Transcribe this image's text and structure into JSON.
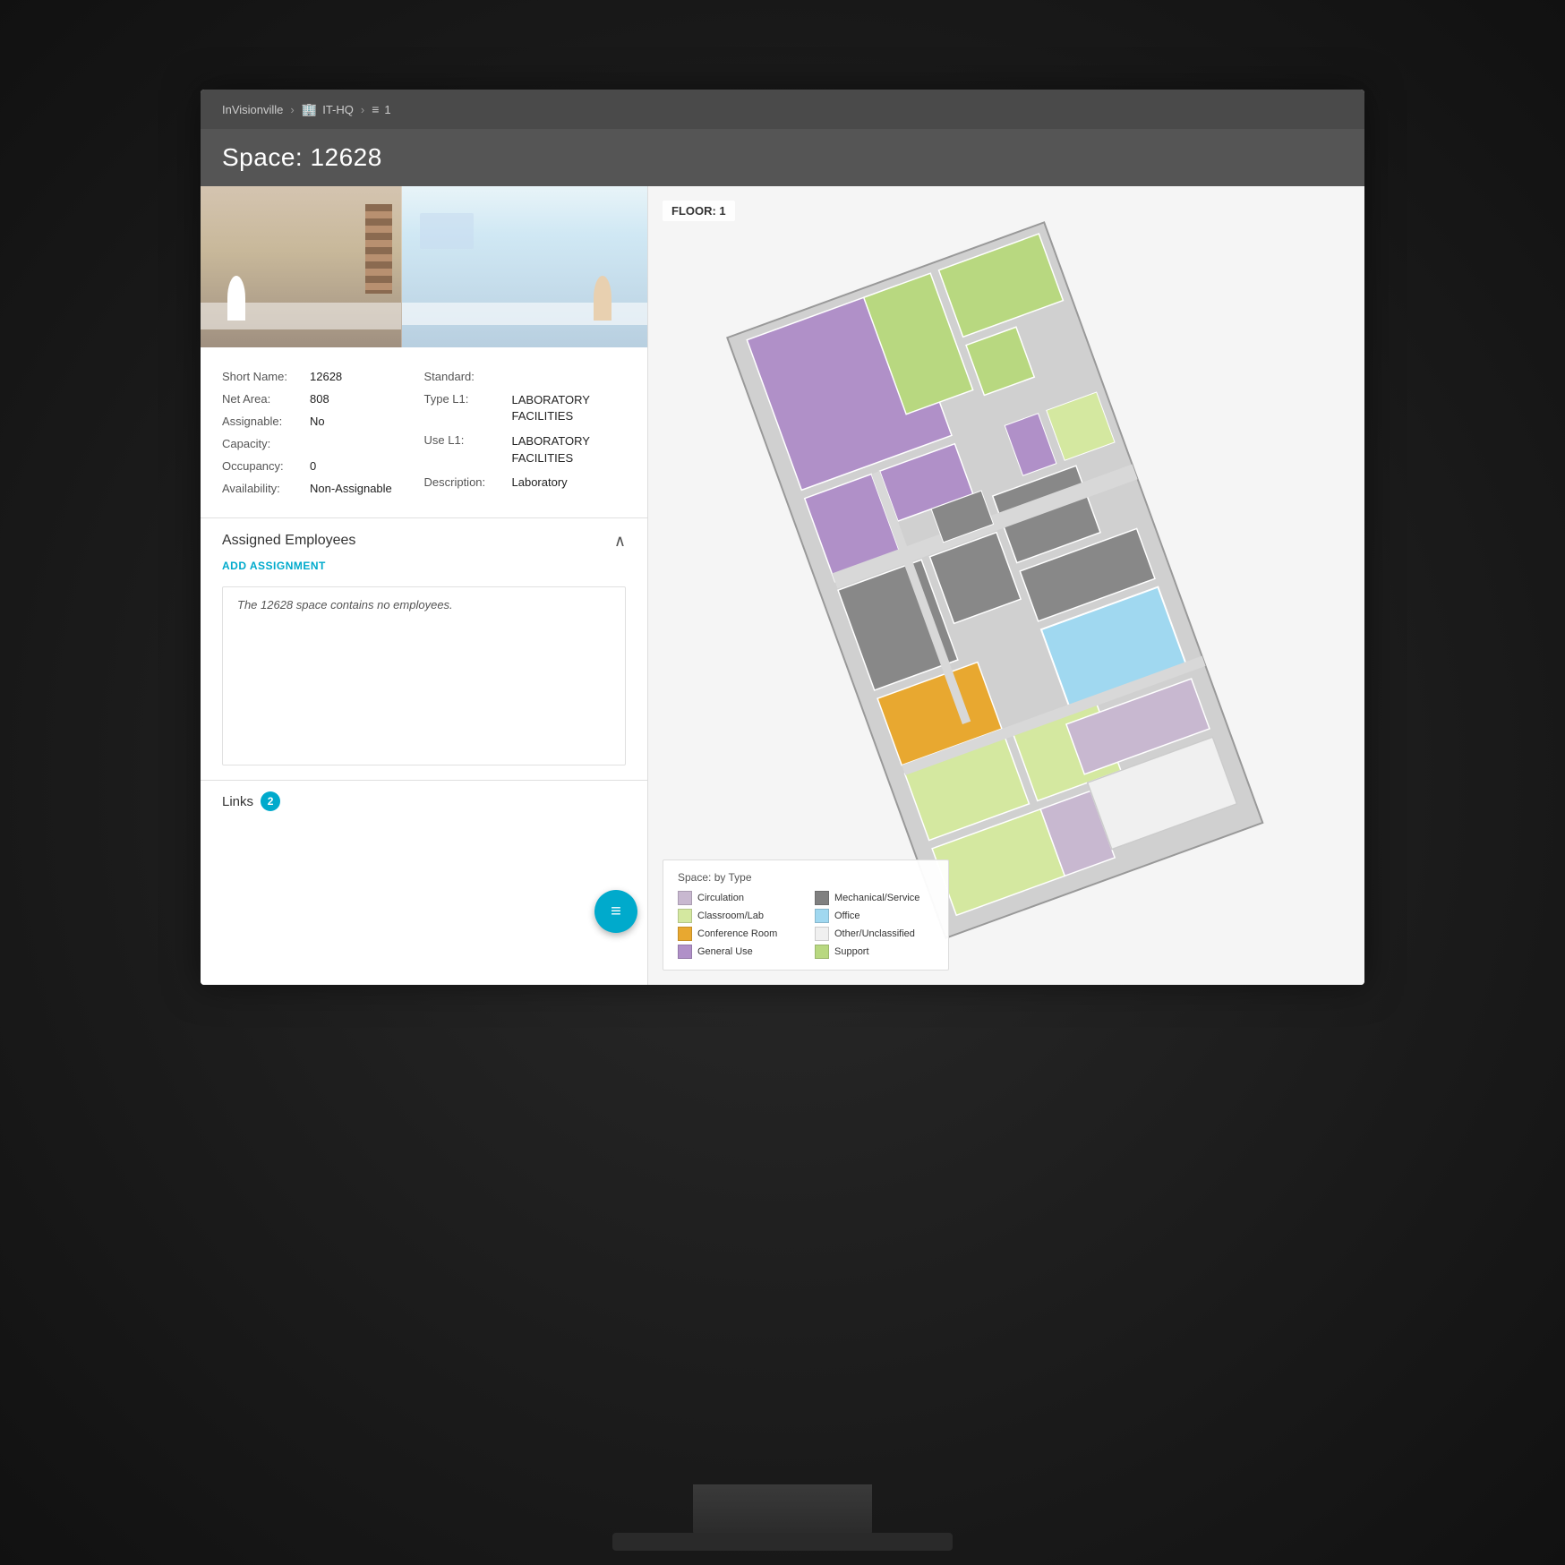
{
  "breadcrumb": {
    "items": [
      {
        "label": "InVisionville",
        "icon": ""
      },
      {
        "label": "IT-HQ",
        "icon": "🏢"
      },
      {
        "label": "1",
        "icon": "≡"
      }
    ]
  },
  "page": {
    "title": "Space: 12628"
  },
  "space_details": {
    "short_name_label": "Short Name:",
    "short_name_value": "12628",
    "net_area_label": "Net Area:",
    "net_area_value": "808",
    "assignable_label": "Assignable:",
    "assignable_value": "No",
    "capacity_label": "Capacity:",
    "capacity_value": "",
    "occupancy_label": "Occupancy:",
    "occupancy_value": "0",
    "availability_label": "Availability:",
    "availability_value": "Non-Assignable",
    "standard_label": "Standard:",
    "standard_value": "",
    "type_l1_label": "Type L1:",
    "type_l1_value": "LABORATORY\nFACILITIES",
    "use_l1_label": "Use L1:",
    "use_l1_value": "LABORATORY\nFACILITIES",
    "description_label": "Description:",
    "description_value": "Laboratory"
  },
  "assigned_employees": {
    "section_title": "Assigned Employees",
    "add_btn_label": "ADD ASSIGNMENT",
    "empty_message": "The 12628 space contains no employees."
  },
  "links": {
    "label": "Links",
    "count": "2"
  },
  "floor_map": {
    "floor_label": "FLOOR: 1"
  },
  "legend": {
    "title": "Space: by Type",
    "items": [
      {
        "label": "Circulation",
        "color": "#c8b8d0"
      },
      {
        "label": "Mechanical/Service",
        "color": "#808080"
      },
      {
        "label": "Classroom/Lab",
        "color": "#d4e8a0"
      },
      {
        "label": "Office",
        "color": "#a0d8f0"
      },
      {
        "label": "Conference Room",
        "color": "#e8a830"
      },
      {
        "label": "Other/Unclassified",
        "color": "#f0f0f0"
      },
      {
        "label": "General Use",
        "color": "#b090c8"
      },
      {
        "label": "Support",
        "color": "#b8d880"
      }
    ]
  }
}
